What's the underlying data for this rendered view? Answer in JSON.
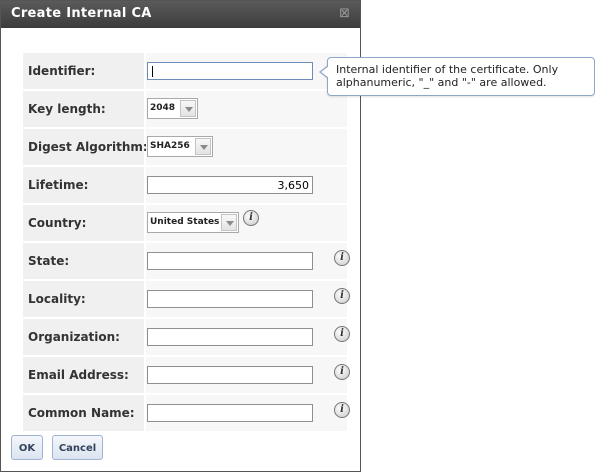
{
  "dialog": {
    "title": "Create Internal CA",
    "close_glyph": "⊠"
  },
  "fields": {
    "identifier": {
      "label": "Identifier:",
      "value": ""
    },
    "key_length": {
      "label": "Key length:",
      "value": "2048"
    },
    "digest_algorithm": {
      "label": "Digest Algorithm:",
      "value": "SHA256"
    },
    "lifetime": {
      "label": "Lifetime:",
      "value": "3,650"
    },
    "country": {
      "label": "Country:",
      "value": "United States"
    },
    "state": {
      "label": "State:",
      "value": ""
    },
    "locality": {
      "label": "Locality:",
      "value": ""
    },
    "organization": {
      "label": "Organization:",
      "value": ""
    },
    "email_address": {
      "label": "Email Address:",
      "value": ""
    },
    "common_name": {
      "label": "Common Name:",
      "value": ""
    }
  },
  "tooltip": {
    "text": "Internal identifier of the certificate. Only alphanumeric, \"_\" and \"-\" are allowed."
  },
  "buttons": {
    "ok_label": "OK",
    "cancel_label": "Cancel"
  },
  "icons": {
    "info_glyph": "i",
    "info_icon_name": "info-icon"
  },
  "colors": {
    "titlebar": "#4a4a4a",
    "label_background": "#f0f0f0",
    "button_border": "#9fb4d3",
    "tooltip_border": "#8fa6c8"
  }
}
